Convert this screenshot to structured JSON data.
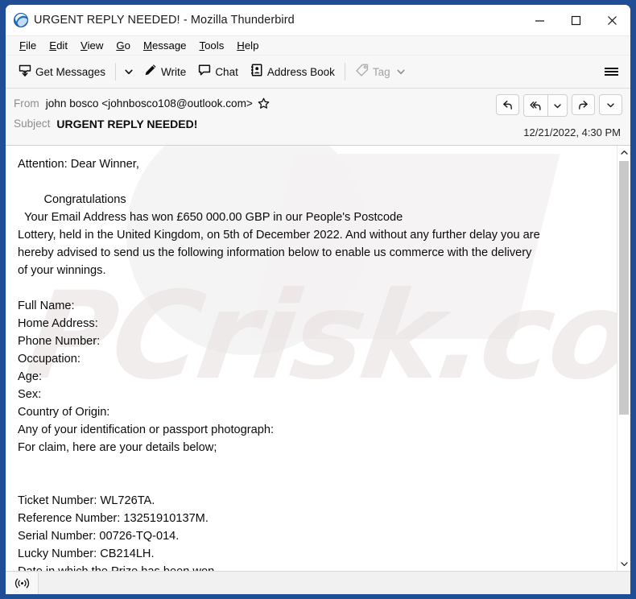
{
  "window": {
    "title": "URGENT REPLY NEEDED! - Mozilla Thunderbird",
    "app_icon": "thunderbird-icon",
    "minimize_label": "─",
    "maximize_label": "□",
    "close_label": "✕",
    "border_color": "#1f4e96"
  },
  "menubar": {
    "items": [
      {
        "accesskey": "F",
        "rest": "ile",
        "name": "file"
      },
      {
        "accesskey": "E",
        "rest": "dit",
        "name": "edit"
      },
      {
        "accesskey": "V",
        "rest": "iew",
        "name": "view"
      },
      {
        "accesskey": "G",
        "rest": "o",
        "name": "go"
      },
      {
        "accesskey": "M",
        "rest": "essage",
        "name": "message"
      },
      {
        "accesskey": "T",
        "rest": "ools",
        "name": "tools"
      },
      {
        "accesskey": "H",
        "rest": "elp",
        "name": "help"
      }
    ]
  },
  "toolbar": {
    "get_messages_label": "Get Messages",
    "write_label": "Write",
    "chat_label": "Chat",
    "address_book_label": "Address Book",
    "tag_label": "Tag",
    "tag_disabled": true,
    "menu_icon": "hamburger-icon"
  },
  "message_header": {
    "from_label": "From",
    "from_value": "john bosco <johnbosco108@outlook.com>",
    "star_icon": "star-outline-icon",
    "subject_label": "Subject",
    "subject_value": "URGENT REPLY NEEDED!",
    "date": "12/21/2022, 4:30 PM",
    "actions": [
      {
        "name": "reply-button",
        "icon": "reply-arrow-icon"
      },
      {
        "name": "reply-all-button",
        "icon": "reply-all-arrow-icon"
      },
      {
        "name": "reply-all-dropdown",
        "icon": "chevron-down-icon"
      },
      {
        "name": "forward-button",
        "icon": "forward-arrow-icon"
      },
      {
        "name": "more-actions-dropdown",
        "icon": "chevron-down-icon"
      }
    ]
  },
  "body": {
    "lines": [
      "Attention: Dear Winner,",
      "",
      "        Congratulations",
      "  Your Email Address has won £650 000.00 GBP in our People's Postcode",
      "Lottery, held in the United Kingdom, on 5th of December 2022. And without any further delay you are",
      "hereby advised to send us the following information below to enable us commerce with the delivery",
      "of your winnings.",
      "",
      "Full Name:",
      "Home Address:",
      "Phone Number:",
      "Occupation:",
      "Age:",
      "Sex:",
      "Country of Origin:",
      "Any of your identification or passport photograph:",
      "For claim, here are your details below;",
      "",
      "",
      "Ticket Number: WL726TA.",
      "Reference Number: 13251910137M.",
      "Serial Number: 00726-TQ-014.",
      "Lucky Number: CB214LH.",
      "Date in which the Prize has been won."
    ],
    "watermark_text": "PCrisk.com"
  },
  "scrollbar": {
    "up_icon": "chevron-up-icon",
    "down_icon": "chevron-down-icon",
    "thumb_name": "scrollbar-thumb"
  },
  "statusbar": {
    "feed_icon": "broadcast-feed-icon",
    "text": ""
  }
}
